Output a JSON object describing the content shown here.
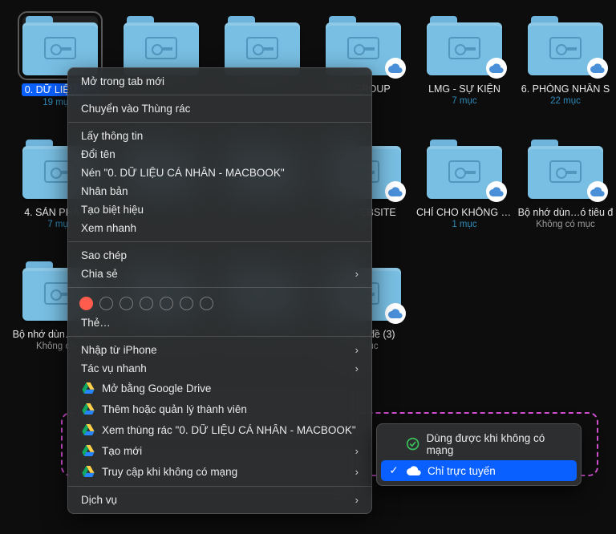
{
  "colors": {
    "accent": "#0a60ff",
    "folder": "#79bfe3",
    "meta": "#2f8ab8",
    "highlight": "#d24fd2"
  },
  "grid": {
    "rows": [
      [
        {
          "name": "0. DỮ LIỆU…- I",
          "meta": "19 mụ…",
          "selected": true,
          "cloud": false
        },
        {
          "name": "",
          "meta": "",
          "cloud": false
        },
        {
          "name": "",
          "meta": "",
          "cloud": false
        },
        {
          "name": "",
          "meta": "",
          "cloud": true
        },
        {
          "name": "LMG - SỰ KIỆN",
          "meta": "7 mục",
          "cloud": true
        },
        {
          "name": "6. PHÒNG NHÂN S",
          "meta": "22 mục",
          "cloud": true
        }
      ],
      [
        {
          "name": "4. SẢN PHẨ…Y",
          "meta": "7 mục",
          "cloud": false
        },
        {
          "name": "",
          "meta": "",
          "cloud": false
        },
        {
          "name": "",
          "meta": "",
          "cloud": false
        },
        {
          "name": "ALL WEBSITE",
          "meta": "mục",
          "cloud": true
        },
        {
          "name": "CHỈ CHO KHÔNG BÁN!!!",
          "meta": "1 mục",
          "cloud": true
        },
        {
          "name": "Bộ nhớ dùn…ó tiêu đ",
          "meta": "Không có mục",
          "cloud": true,
          "metaNone": true
        }
      ],
      [
        {
          "name": "Bộ nhớ dùn…ó tiêu đ",
          "meta": "Không có…",
          "cloud": false,
          "metaNone": true
        },
        {
          "name": "",
          "meta": "",
          "cloud": false
        },
        {
          "name": "",
          "meta": "",
          "cloud": false
        },
        {
          "name": "…ó tiêu đề (3)",
          "meta": "có mục",
          "cloud": true,
          "metaNone": true
        },
        {
          "name": "",
          "meta": "",
          "cloud": false,
          "empty": true
        },
        {
          "name": "",
          "meta": "",
          "cloud": false,
          "empty": true
        }
      ]
    ],
    "groupName": "NH GROUP"
  },
  "menu": {
    "items": [
      {
        "label": "Mở trong tab mới"
      },
      {
        "sep": true
      },
      {
        "label": "Chuyển vào Thùng rác"
      },
      {
        "sep": true
      },
      {
        "label": "Lấy thông tin"
      },
      {
        "label": "Đổi tên"
      },
      {
        "label": "Nén \"0. DỮ LIỆU CÁ NHÂN - MACBOOK\""
      },
      {
        "label": "Nhân bản"
      },
      {
        "label": "Tạo biệt hiệu"
      },
      {
        "label": "Xem nhanh"
      },
      {
        "sep": true
      },
      {
        "label": "Sao chép"
      },
      {
        "label": "Chia sẻ",
        "sub": true
      },
      {
        "sep": true
      },
      {
        "tags": true
      },
      {
        "label": "Thẻ…"
      },
      {
        "sep": true
      },
      {
        "label": "Nhập từ iPhone",
        "sub": true
      },
      {
        "label": "Tác vụ nhanh",
        "sub": true
      },
      {
        "icon": "gdrive",
        "label": "Mở bằng Google Drive"
      },
      {
        "icon": "gdrive",
        "label": "Thêm hoặc quản lý thành viên"
      },
      {
        "icon": "gdrive",
        "label": "Xem thùng rác \"0. DỮ LIỆU CÁ NHÂN - MACBOOK\""
      },
      {
        "icon": "gdrive",
        "label": "Tạo mới",
        "sub": true
      },
      {
        "icon": "gdrive",
        "label": "Truy cập khi không có mạng",
        "sub": true
      },
      {
        "sep": true
      },
      {
        "label": "Dịch vụ",
        "sub": true
      }
    ]
  },
  "submenu": {
    "items": [
      {
        "checked": false,
        "icon": "check-green",
        "label": "Dùng được khi không có mạng"
      },
      {
        "checked": true,
        "icon": "cloud",
        "label": "Chỉ trực tuyến",
        "hl": true
      }
    ]
  }
}
